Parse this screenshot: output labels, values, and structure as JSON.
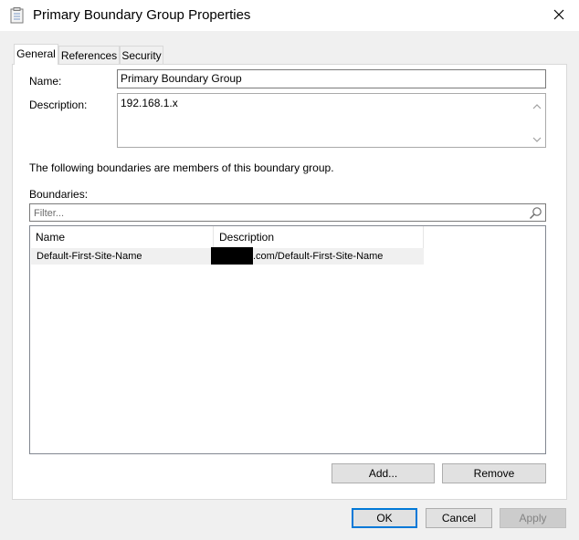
{
  "window": {
    "title": "Primary Boundary Group Properties",
    "close_label": "✕",
    "icon": "properties-sheet-icon"
  },
  "tabs": [
    {
      "label": "General",
      "active": true
    },
    {
      "label": "References",
      "active": false
    },
    {
      "label": "Security",
      "active": false
    }
  ],
  "general": {
    "name_label": "Name:",
    "name_value": "Primary Boundary Group",
    "description_label": "Description:",
    "description_value": "192.168.1.x",
    "members_text": "The following boundaries are members of this boundary group.",
    "boundaries_label": "Boundaries:",
    "filter_placeholder": "Filter...",
    "filter_icon": "search-icon",
    "columns": [
      "Name",
      "Description"
    ],
    "rows": [
      {
        "name": "Default-First-Site-Name",
        "description": ".com/Default-First-Site-Name"
      }
    ],
    "add_label": "Add...",
    "remove_label": "Remove"
  },
  "footer": {
    "ok_label": "OK",
    "cancel_label": "Cancel",
    "apply_label": "Apply"
  },
  "colors": {
    "accent": "#0078d7",
    "dialog_bg": "#f0f0f0",
    "redaction": "#000000"
  }
}
